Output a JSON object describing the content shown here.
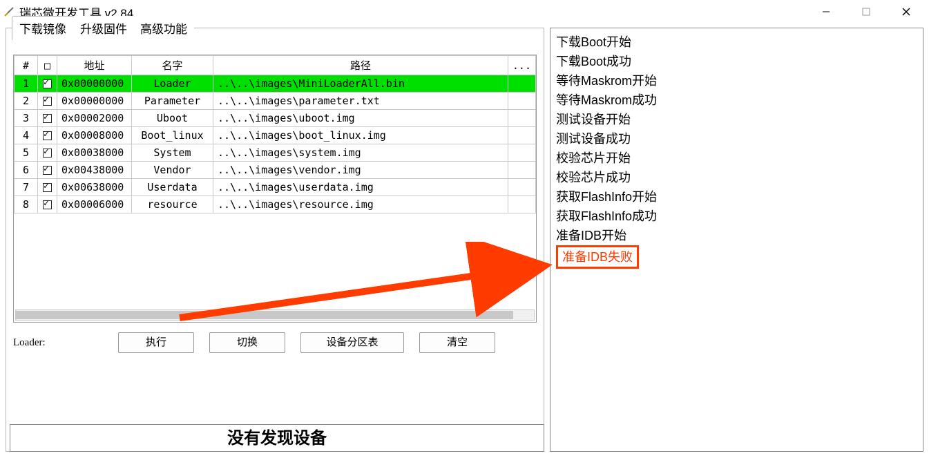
{
  "window": {
    "title": "瑞芯微开发工具 v2.84"
  },
  "tabs": {
    "download": "下载镜像",
    "upgrade": "升级固件",
    "advanced": "高级功能"
  },
  "table": {
    "headers": {
      "num": "#",
      "chk": "□",
      "addr": "地址",
      "name": "名字",
      "path": "路径",
      "dots": "..."
    },
    "rows": [
      {
        "n": "1",
        "checked": true,
        "addr": "0x00000000",
        "name": "Loader",
        "path": "..\\..\\images\\MiniLoaderAll.bin",
        "green": true
      },
      {
        "n": "2",
        "checked": true,
        "addr": "0x00000000",
        "name": "Parameter",
        "path": "..\\..\\images\\parameter.txt",
        "green": false
      },
      {
        "n": "3",
        "checked": true,
        "addr": "0x00002000",
        "name": "Uboot",
        "path": "..\\..\\images\\uboot.img",
        "green": false
      },
      {
        "n": "4",
        "checked": true,
        "addr": "0x00008000",
        "name": "Boot_linux",
        "path": "..\\..\\images\\boot_linux.img",
        "green": false
      },
      {
        "n": "5",
        "checked": true,
        "addr": "0x00038000",
        "name": "System",
        "path": "..\\..\\images\\system.img",
        "green": false
      },
      {
        "n": "6",
        "checked": true,
        "addr": "0x00438000",
        "name": "Vendor",
        "path": "..\\..\\images\\vendor.img",
        "green": false
      },
      {
        "n": "7",
        "checked": true,
        "addr": "0x00638000",
        "name": "Userdata",
        "path": "..\\..\\images\\userdata.img",
        "green": false
      },
      {
        "n": "8",
        "checked": true,
        "addr": "0x00006000",
        "name": "resource",
        "path": "..\\..\\images\\resource.img",
        "green": false
      }
    ]
  },
  "buttons": {
    "loader_label": "Loader:",
    "execute": "执行",
    "switch": "切换",
    "partition": "设备分区表",
    "clear": "清空"
  },
  "log": [
    {
      "text": "下载Boot开始",
      "error": false
    },
    {
      "text": "下载Boot成功",
      "error": false
    },
    {
      "text": "等待Maskrom开始",
      "error": false
    },
    {
      "text": "等待Maskrom成功",
      "error": false
    },
    {
      "text": "测试设备开始",
      "error": false
    },
    {
      "text": "测试设备成功",
      "error": false
    },
    {
      "text": "校验芯片开始",
      "error": false
    },
    {
      "text": "校验芯片成功",
      "error": false
    },
    {
      "text": "获取FlashInfo开始",
      "error": false
    },
    {
      "text": "获取FlashInfo成功",
      "error": false
    },
    {
      "text": "准备IDB开始",
      "error": false
    },
    {
      "text": "准备IDB失败",
      "error": true
    }
  ],
  "status": "没有发现设备"
}
